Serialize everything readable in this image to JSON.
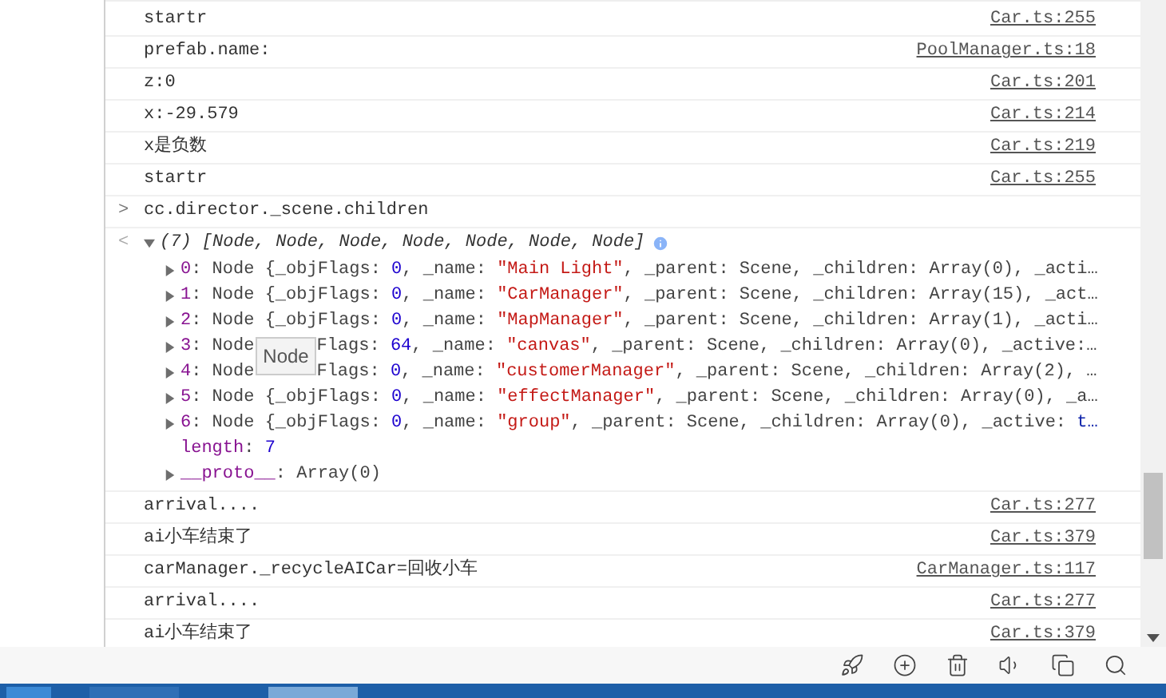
{
  "console_rows": [
    {
      "kind": "log",
      "message": "startr",
      "source": "Car.ts:255"
    },
    {
      "kind": "log",
      "message": "prefab.name:",
      "source": "PoolManager.ts:18"
    },
    {
      "kind": "log",
      "message": "z:0",
      "source": "Car.ts:201"
    },
    {
      "kind": "log",
      "message": "x:-29.579",
      "source": "Car.ts:214"
    },
    {
      "kind": "log",
      "message": "x是负数",
      "source": "Car.ts:219"
    },
    {
      "kind": "log",
      "message": "startr",
      "source": "Car.ts:255"
    },
    {
      "kind": "input",
      "prompt": ">",
      "command": "cc.director._scene.children"
    },
    {
      "kind": "result",
      "marker": "<",
      "summary": "(7) [Node, Node, Node, Node, Node, Node, Node]",
      "expanded": true,
      "items": [
        {
          "kind": "entry",
          "expanded": false,
          "key": "0",
          "head": ": Node {_objFlags: ",
          "number": "0",
          "mid": ", _name: ",
          "string": "\"Main Light\"",
          "tail": ", _parent: Scene, _children: Array(0), _acti…"
        },
        {
          "kind": "entry",
          "expanded": false,
          "key": "1",
          "head": ": Node {_objFlags: ",
          "number": "0",
          "mid": ", _name: ",
          "string": "\"CarManager\"",
          "tail": ", _parent: Scene, _children: Array(15), _act…"
        },
        {
          "kind": "entry",
          "expanded": false,
          "key": "2",
          "head": ": Node {_objFlags: ",
          "number": "0",
          "mid": ", _name: ",
          "string": "\"MapManager\"",
          "tail": ", _parent: Scene, _children: Array(1), _acti…"
        },
        {
          "kind": "covered_entry",
          "expanded": false,
          "key": "3",
          "head": ": Node",
          "after_gap": "Flags: ",
          "number": "64",
          "mid": ", _name: ",
          "string": "\"canvas\"",
          "tail": ", _parent: Scene, _children: Array(0), _active:…"
        },
        {
          "kind": "covered_entry",
          "expanded": false,
          "key": "4",
          "head": ": Node",
          "after_gap": "Flags: ",
          "number": "0",
          "mid": ", _name: ",
          "string": "\"customerManager\"",
          "tail": ", _parent: Scene, _children: Array(2), …"
        },
        {
          "kind": "entry",
          "expanded": false,
          "key": "5",
          "head": ": Node {_objFlags: ",
          "number": "0",
          "mid": ", _name: ",
          "string": "\"effectManager\"",
          "tail": ", _parent: Scene, _children: Array(0), _a…"
        },
        {
          "kind": "entry",
          "expanded": false,
          "key": "6",
          "head": ": Node {_objFlags: ",
          "number": "0",
          "mid": ", _name: ",
          "string": "\"group\"",
          "tail": ", _parent: Scene, _children: Array(0), _active: ",
          "keyword": "t…"
        },
        {
          "kind": "property",
          "key": "length",
          "head": ": ",
          "number": "7"
        },
        {
          "kind": "entry",
          "expanded": false,
          "key": "__proto__",
          "head": ": Array(0)"
        }
      ]
    },
    {
      "kind": "log",
      "message": "arrival....",
      "source": "Car.ts:277"
    },
    {
      "kind": "log",
      "message": "ai小车结束了",
      "source": "Car.ts:379"
    },
    {
      "kind": "log",
      "message": "carManager._recycleAICar=回收小车",
      "source": "CarManager.ts:117"
    },
    {
      "kind": "log",
      "message": "arrival....",
      "source": "Car.ts:277"
    },
    {
      "kind": "log",
      "message": "ai小车结束了",
      "source": "Car.ts:379"
    }
  ],
  "tooltip": {
    "text": "Node"
  }
}
